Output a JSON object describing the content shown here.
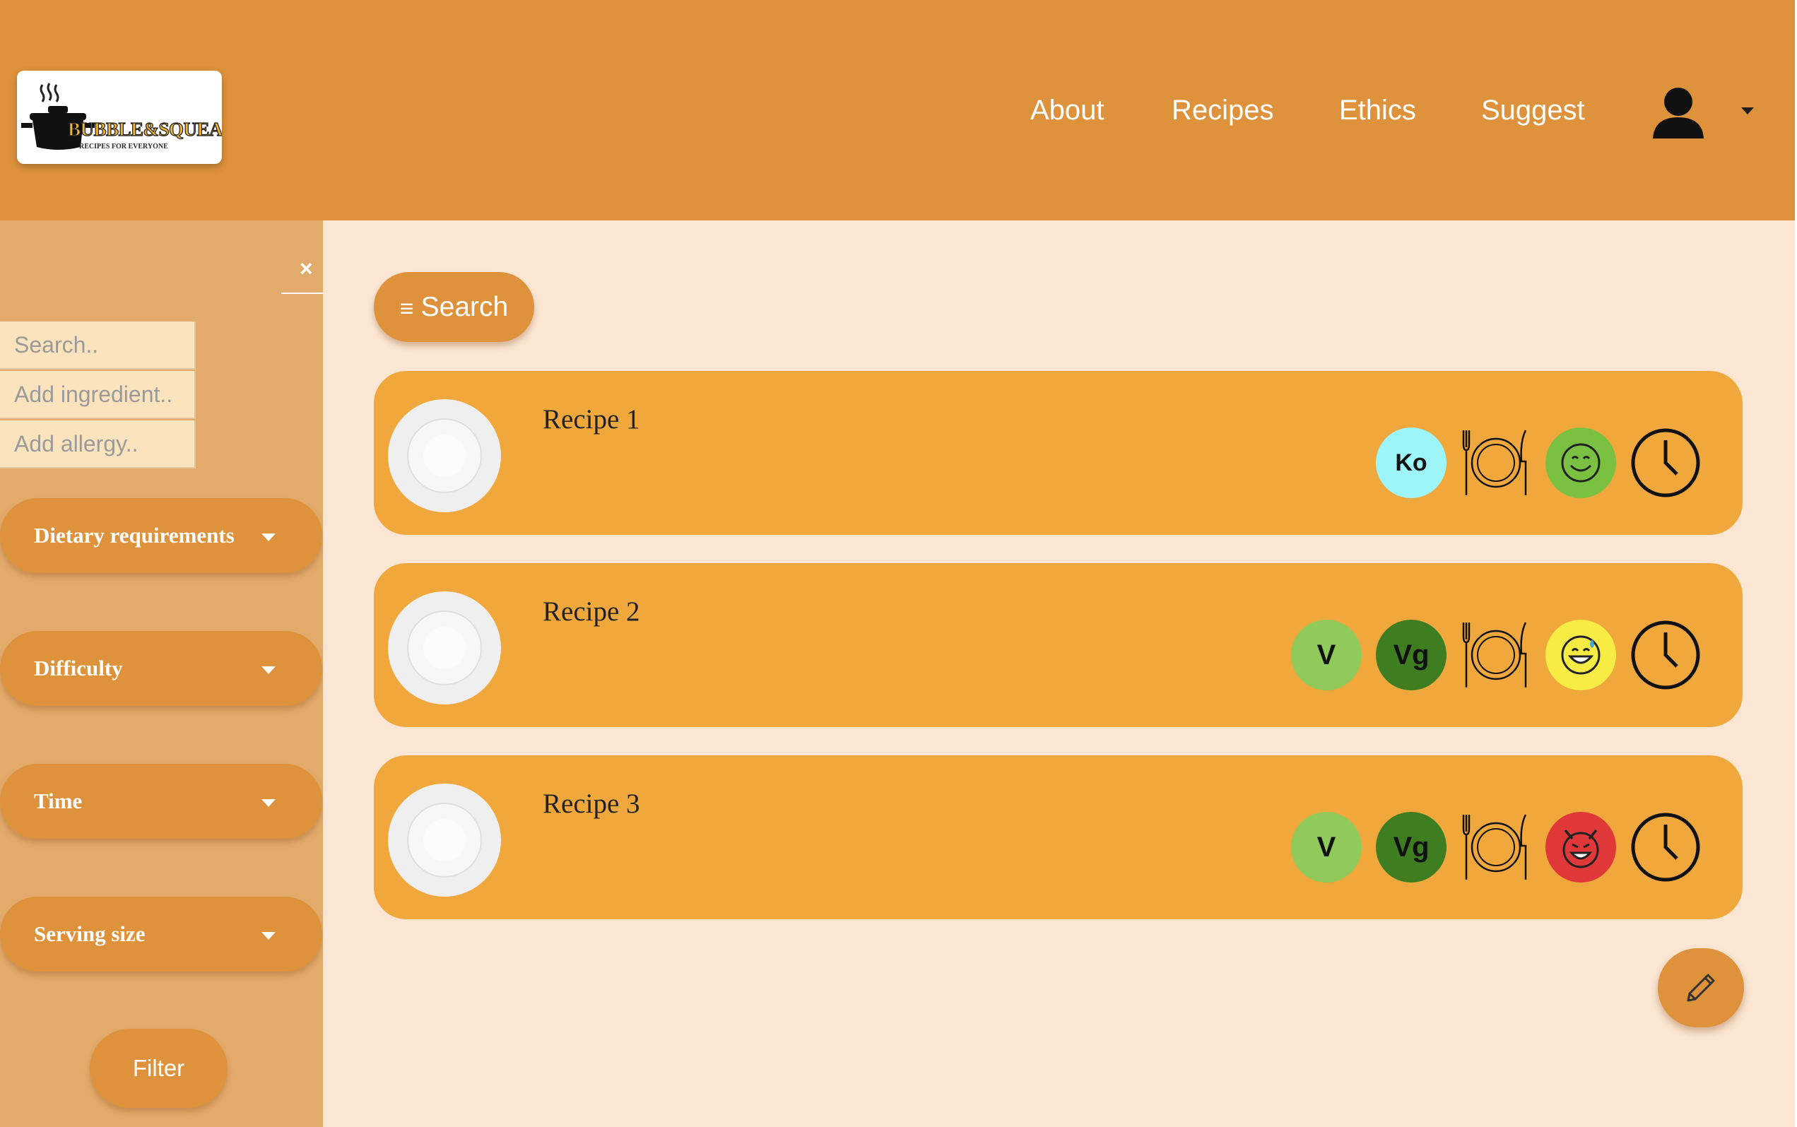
{
  "header": {
    "logo_text": "BUBBLE&SQUEAK",
    "logo_tagline": "RECIPES FOR EVERYONE",
    "nav": [
      {
        "label": "About"
      },
      {
        "label": "Recipes"
      },
      {
        "label": "Ethics"
      },
      {
        "label": "Suggest"
      }
    ],
    "user_icon": "user-icon",
    "colors": {
      "primary": "#de923c",
      "sidebar": "#e3ab6b",
      "main_bg": "#fae6d3",
      "card": "#f0a83c"
    }
  },
  "sidebar": {
    "close_label": "×",
    "search_placeholder": "Search..",
    "ingredient_placeholder": "Add ingredient..",
    "allergy_placeholder": "Add allergy..",
    "filters": [
      {
        "label": "Dietary requirements"
      },
      {
        "label": "Difficulty"
      },
      {
        "label": "Time"
      },
      {
        "label": "Serving size"
      }
    ],
    "filter_button": "Filter"
  },
  "main": {
    "search_button": "Search",
    "search_icon": "≡",
    "recipes": [
      {
        "title": "Recipe 1",
        "badges": [
          {
            "text": "Ko",
            "color": "#9df5f9"
          }
        ],
        "difficulty_icon": "smile-icon",
        "difficulty_color": "#7ac142"
      },
      {
        "title": "Recipe 2",
        "badges": [
          {
            "text": "V",
            "color": "#8fca5b"
          },
          {
            "text": "Vg",
            "color": "#3f7d21"
          }
        ],
        "difficulty_icon": "sweat-smile-icon",
        "difficulty_color": "#f7ec44"
      },
      {
        "title": "Recipe 3",
        "badges": [
          {
            "text": "V",
            "color": "#8fca5b"
          },
          {
            "text": "Vg",
            "color": "#3f7d21"
          }
        ],
        "difficulty_icon": "devil-icon",
        "difficulty_color": "#e03838"
      }
    ],
    "fab_icon": "pencil-icon"
  }
}
